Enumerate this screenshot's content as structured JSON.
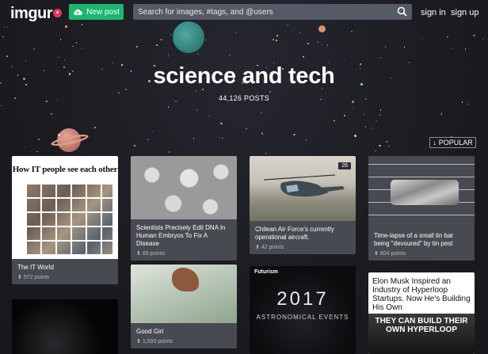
{
  "header": {
    "logo": "imgur",
    "new_post_label": "New post",
    "search_placeholder": "Search for images, #tags, and @users",
    "sign_in_label": "sign in",
    "sign_up_label": "sign up"
  },
  "tag": {
    "title": "science and tech",
    "post_count": "44,126 POSTS",
    "sort_label": "POPULAR"
  },
  "posts": [
    {
      "title": "The IT World",
      "points": "972 points",
      "image_text": "How IT people see each other"
    },
    {
      "title": "Scientists Precisely Edit DNA In Human Embryos To Fix A Disease",
      "points": "69 points"
    },
    {
      "title": "Chilean Air Force's currently operational aircraft.",
      "points": "42 points",
      "badge": "26"
    },
    {
      "title": "Time-lapse of a small tin bar being \"devoured\" by tin pest",
      "points": "804 points"
    },
    {
      "title": "Good Girl",
      "points": "1,593 points"
    },
    {
      "image_text_brand": "Futurism",
      "image_text_year": "2017",
      "image_text_sub": "ASTRONOMICAL EVENTS"
    },
    {
      "image_text_headline": "Elon Musk Inspired an Industry of Hyperloop Startups. Now He's Building His Own",
      "image_text_overlay": "THEY CAN BUILD THEIR OWN HYPERLOOP"
    }
  ],
  "colors": {
    "new_post_green": "#1bb76e",
    "logo_dot": "#e0385a",
    "card_bg": "#474a51",
    "page_bg": "#1b1b20"
  }
}
